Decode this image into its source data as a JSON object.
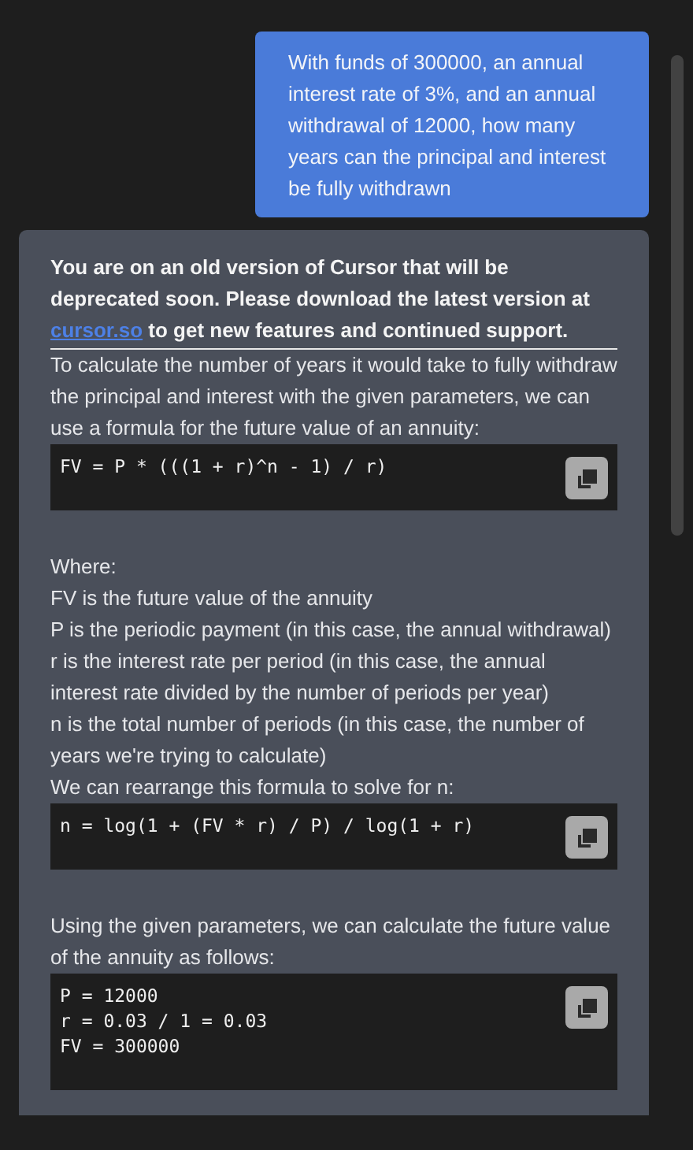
{
  "user_message": {
    "text": "With funds of 300000, an annual interest rate of 3%, and an annual withdrawal of 12000, how many years can the principal and interest be fully withdrawn"
  },
  "assistant_message": {
    "notice": {
      "before": "You are on an old version of Cursor that will be deprecated soon. Please download the latest version at ",
      "link": "cursor.so",
      "after": " to get new features and continued support."
    },
    "blocks": [
      {
        "kind": "text",
        "lines": [
          "To calculate the number of years it would take to fully withdraw the principal and interest with the given parameters, we can use a formula for the future value of an annuity:"
        ]
      },
      {
        "kind": "code",
        "lines": [
          "FV = P * (((1 + r)^n - 1) / r)"
        ]
      },
      {
        "kind": "text",
        "lines": [
          "Where:",
          "FV is the future value of the annuity",
          "P is the periodic payment (in this case, the annual withdrawal)",
          "r is the interest rate per period (in this case, the annual interest rate divided by the number of periods per year)",
          "n is the total number of periods (in this case, the number of years we're trying to calculate)",
          "We can rearrange this formula to solve for n:"
        ]
      },
      {
        "kind": "code",
        "lines": [
          "n = log(1 + (FV * r) / P) / log(1 + r)"
        ]
      },
      {
        "kind": "text",
        "lines": [
          "Using the given parameters, we can calculate the future value of the annuity as follows:"
        ]
      },
      {
        "kind": "code",
        "lines": [
          "P = 12000",
          "r = 0.03 / 1 = 0.03",
          "FV = 300000"
        ]
      }
    ]
  }
}
